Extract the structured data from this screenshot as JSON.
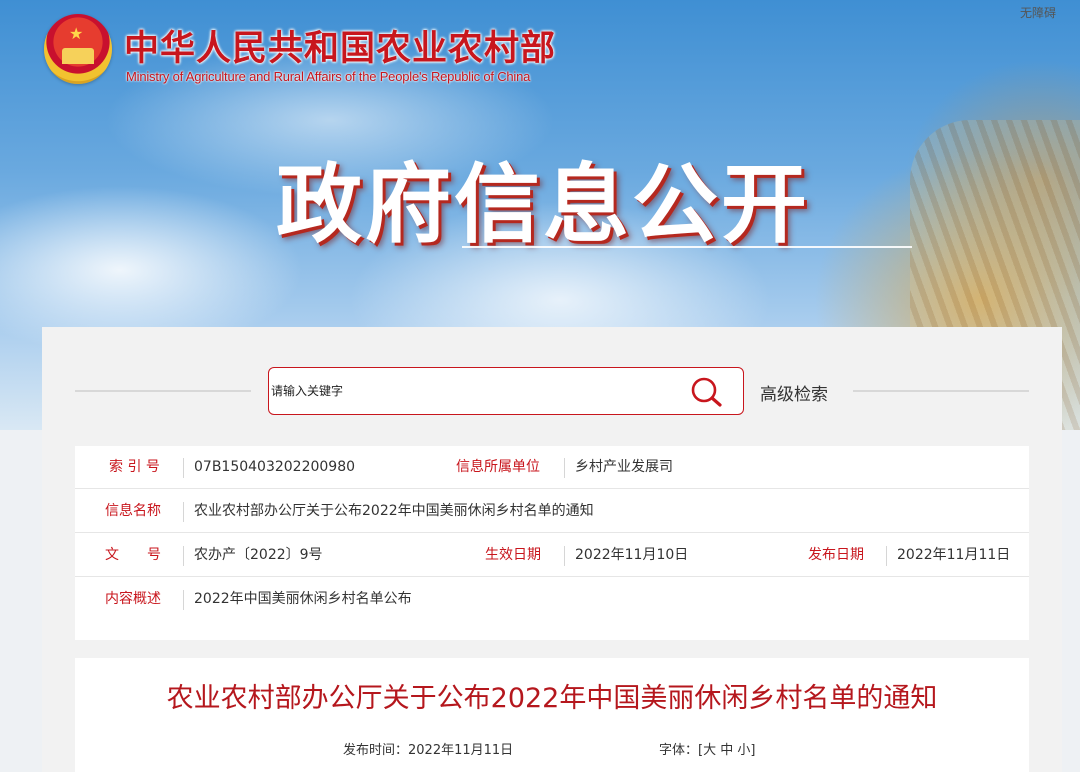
{
  "header": {
    "ministry_name_cn": "中华人民共和国农业农村部",
    "ministry_name_en": "Ministry of Agriculture and Rural Affairs of the People's Republic of China",
    "accessibility_link": "无障碍",
    "banner_title": "政府信息公开"
  },
  "search": {
    "placeholder": "请输入关键字",
    "advanced_label": "高级检索",
    "icon": "search-icon"
  },
  "info": {
    "index_label": "索 引 号",
    "index_value": "07B150403202200980",
    "unit_label": "信息所属单位",
    "unit_value": "乡村产业发展司",
    "name_label": "信息名称",
    "name_value": "农业农村部办公厅关于公布2022年中国美丽休闲乡村名单的通知",
    "doc_label": "文　　号",
    "doc_value": "农办产〔2022〕9号",
    "effective_label": "生效日期",
    "effective_value": "2022年11月10日",
    "publish_label": "发布日期",
    "publish_value": "2022年11月11日",
    "summary_label": "内容概述",
    "summary_value": "2022年中国美丽休闲乡村名单公布"
  },
  "article": {
    "title": "农业农村部办公厅关于公布2022年中国美丽休闲乡村名单的通知",
    "publish_time_label": "发布时间：",
    "publish_time_value": "2022年11月11日",
    "font_label": "字体：",
    "font_bracket_open": "[",
    "font_large": "大",
    "font_medium": "中",
    "font_small": "小",
    "font_bracket_close": "]"
  },
  "colors": {
    "accent_red": "#c8161d",
    "title_red": "#b5171d"
  }
}
